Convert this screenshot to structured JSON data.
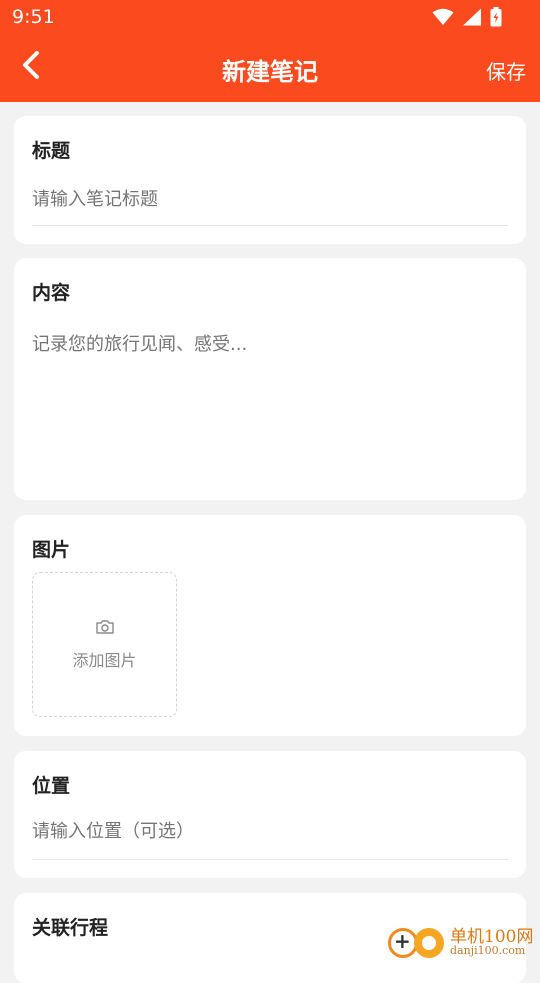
{
  "status_bar": {
    "time": "9:51",
    "icons": [
      "wifi-icon",
      "signal-icon",
      "battery-icon"
    ]
  },
  "app_bar": {
    "title": "新建笔记",
    "save_label": "保存",
    "back_icon": "chevron-left-icon"
  },
  "colors": {
    "primary": "#fc4a1f",
    "background": "#f2f2f2",
    "card": "#ffffff"
  },
  "form": {
    "title_section": {
      "label": "标题",
      "placeholder": "请输入笔记标题"
    },
    "content_section": {
      "label": "内容",
      "placeholder": "记录您的旅行见闻、感受..."
    },
    "images_section": {
      "label": "图片",
      "add_label": "添加图片",
      "add_icon": "camera-icon"
    },
    "location_section": {
      "label": "位置",
      "placeholder": "请输入位置（可选）"
    },
    "trip_section": {
      "label": "关联行程"
    }
  },
  "watermark": {
    "name": "单机100网",
    "url": "danji100.com"
  }
}
